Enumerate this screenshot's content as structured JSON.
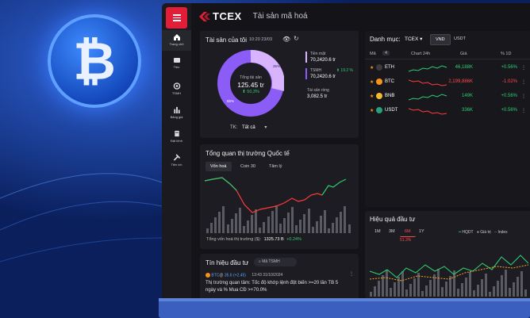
{
  "app": {
    "logo": "TCEX",
    "page_title": "Tài sản mã hoá"
  },
  "sidebar": {
    "items": [
      {
        "label": "Trang chủ",
        "icon": "home-icon"
      },
      {
        "label": "Tiền",
        "icon": "wallet-icon"
      },
      {
        "label": "TSMH",
        "icon": "coin-icon"
      },
      {
        "label": "Bảng giá",
        "icon": "bar-chart-icon"
      },
      {
        "label": "Đặt lệnh",
        "icon": "order-icon"
      },
      {
        "label": "Tiện ích",
        "icon": "tools-icon"
      }
    ]
  },
  "assets": {
    "title": "Tài sản của tôi",
    "time": "10:20 23/03",
    "center_label": "Tổng tài sản",
    "center_value": "125.45 tr",
    "center_change": "50,3%",
    "slice_cash": "35%",
    "slice_tsmh": "65%",
    "cash_label": "Tiền mặt",
    "cash_value": "70,2420.6 tr",
    "tsmh_label": "TSMH",
    "tsmh_value": "70,2420.6 tr",
    "tsmh_change": "19.2 %",
    "net_label": "Tài sản ròng",
    "net_value": "3,082.5 tr",
    "account_label": "TK:",
    "account_value": "Tất cả",
    "colors": {
      "cash": "#d8b4fe",
      "tsmh": "#8b5cf6"
    }
  },
  "watchlist": {
    "label": "Danh mục:",
    "value": "TCEX",
    "currency_vnd": "VND",
    "currency_usdt": "USDT",
    "col_symbol": "Mã",
    "count": "4",
    "col_chart": "Chart 24h",
    "col_price": "Giá",
    "col_change": "% 1D",
    "rows": [
      {
        "symbol": "ETH",
        "price": "46,188K",
        "change": "+0.56%",
        "dir": "up",
        "color": "#3c3c3d"
      },
      {
        "symbol": "BTC",
        "price": "2,199,886K",
        "change": "-1.02%",
        "dir": "down",
        "color": "#f7931a"
      },
      {
        "symbol": "BNB",
        "price": "149K",
        "change": "+0.56%",
        "dir": "up",
        "color": "#f3ba2f"
      },
      {
        "symbol": "USDT",
        "price": "336K",
        "change": "+0.56%",
        "dir": "down",
        "color": "#26a17b"
      }
    ]
  },
  "market": {
    "title": "Tổng quan thị trường Quốc tế",
    "tabs": [
      "Vốn hoá",
      "Coin 30",
      "Tâm lý"
    ],
    "cap_label": "Tổng vốn hoá thị trường ($):",
    "cap_value": "1325.73 B",
    "cap_change": "+0.24%"
  },
  "signals": {
    "title": "Tín hiệu đầu tư",
    "search_placeholder": "Mã TSMH",
    "item_symbol": "BTC",
    "item_change": "35.6 (+2.45)",
    "item_time": "13:43 31/10/2024",
    "item_text": "Thị trường quan tâm: Tốc độ khớp lệnh đột biến >=20 lần TB 5 ngày và % Mua CĐ >+70.0%"
  },
  "perf": {
    "title": "Hiệu quả đầu tư",
    "periods": [
      "1M",
      "3M",
      "6M",
      "1Y"
    ],
    "period_value": "51.3%",
    "legend": [
      "HQDT",
      "Giá trị",
      "Index"
    ]
  }
}
